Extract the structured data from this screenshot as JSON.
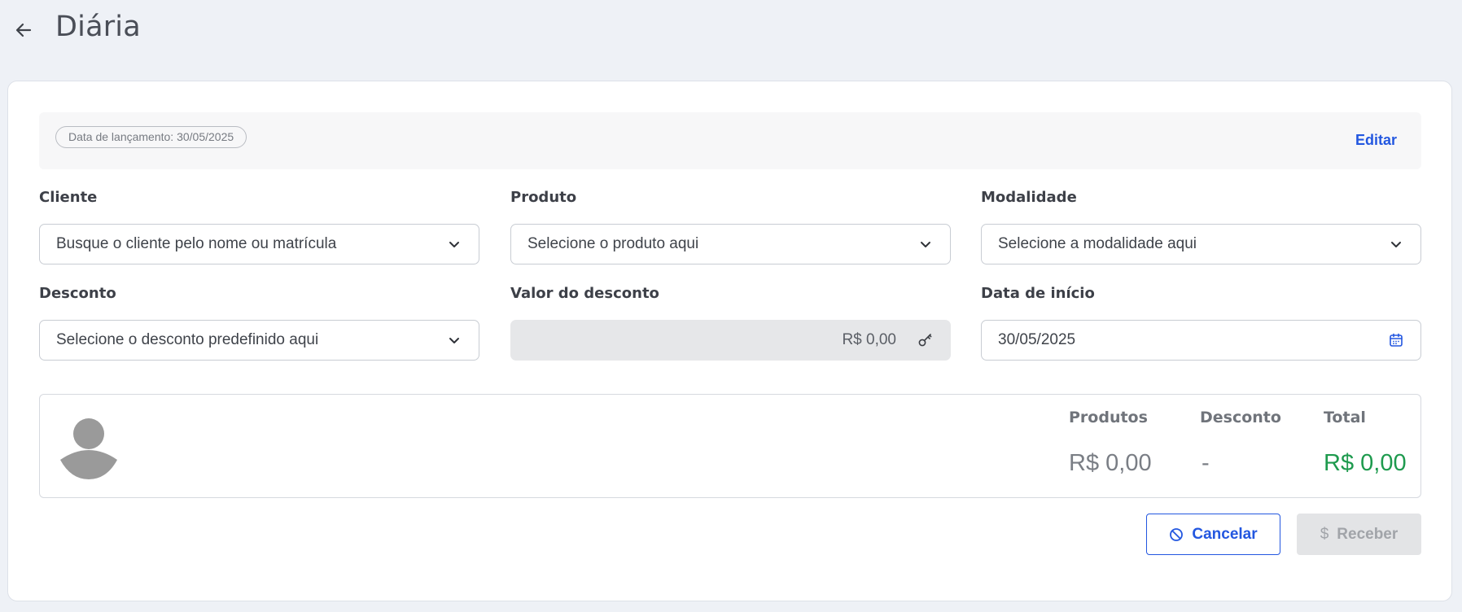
{
  "header": {
    "title": "Diária",
    "back_icon": "arrow-left-icon"
  },
  "info_bar": {
    "launch_date": "Data de lançamento: 30/05/2025",
    "edit_label": "Editar"
  },
  "form": {
    "cliente": {
      "label": "Cliente",
      "placeholder": "Busque o cliente pelo nome ou matrícula"
    },
    "produto": {
      "label": "Produto",
      "placeholder": "Selecione o produto aqui"
    },
    "modalidade": {
      "label": "Modalidade",
      "placeholder": "Selecione a modalidade aqui"
    },
    "desconto": {
      "label": "Desconto",
      "placeholder": "Selecione o desconto predefinido aqui"
    },
    "valor_desconto": {
      "label": "Valor do desconto",
      "value": "R$ 0,00",
      "icon": "key-icon"
    },
    "data_inicio": {
      "label": "Data de início",
      "value": "30/05/2025",
      "icon": "calendar-icon"
    }
  },
  "summary": {
    "produtos_label": "Produtos",
    "produtos_value": "R$ 0,00",
    "desconto_label": "Desconto",
    "desconto_value": "-",
    "total_label": "Total",
    "total_value": "R$ 0,00"
  },
  "actions": {
    "cancel_label": "Cancelar",
    "receive_label": "Receber"
  },
  "colors": {
    "accent": "#2357e0",
    "total_green": "#1e9a4e",
    "background": "#eef1f6"
  }
}
